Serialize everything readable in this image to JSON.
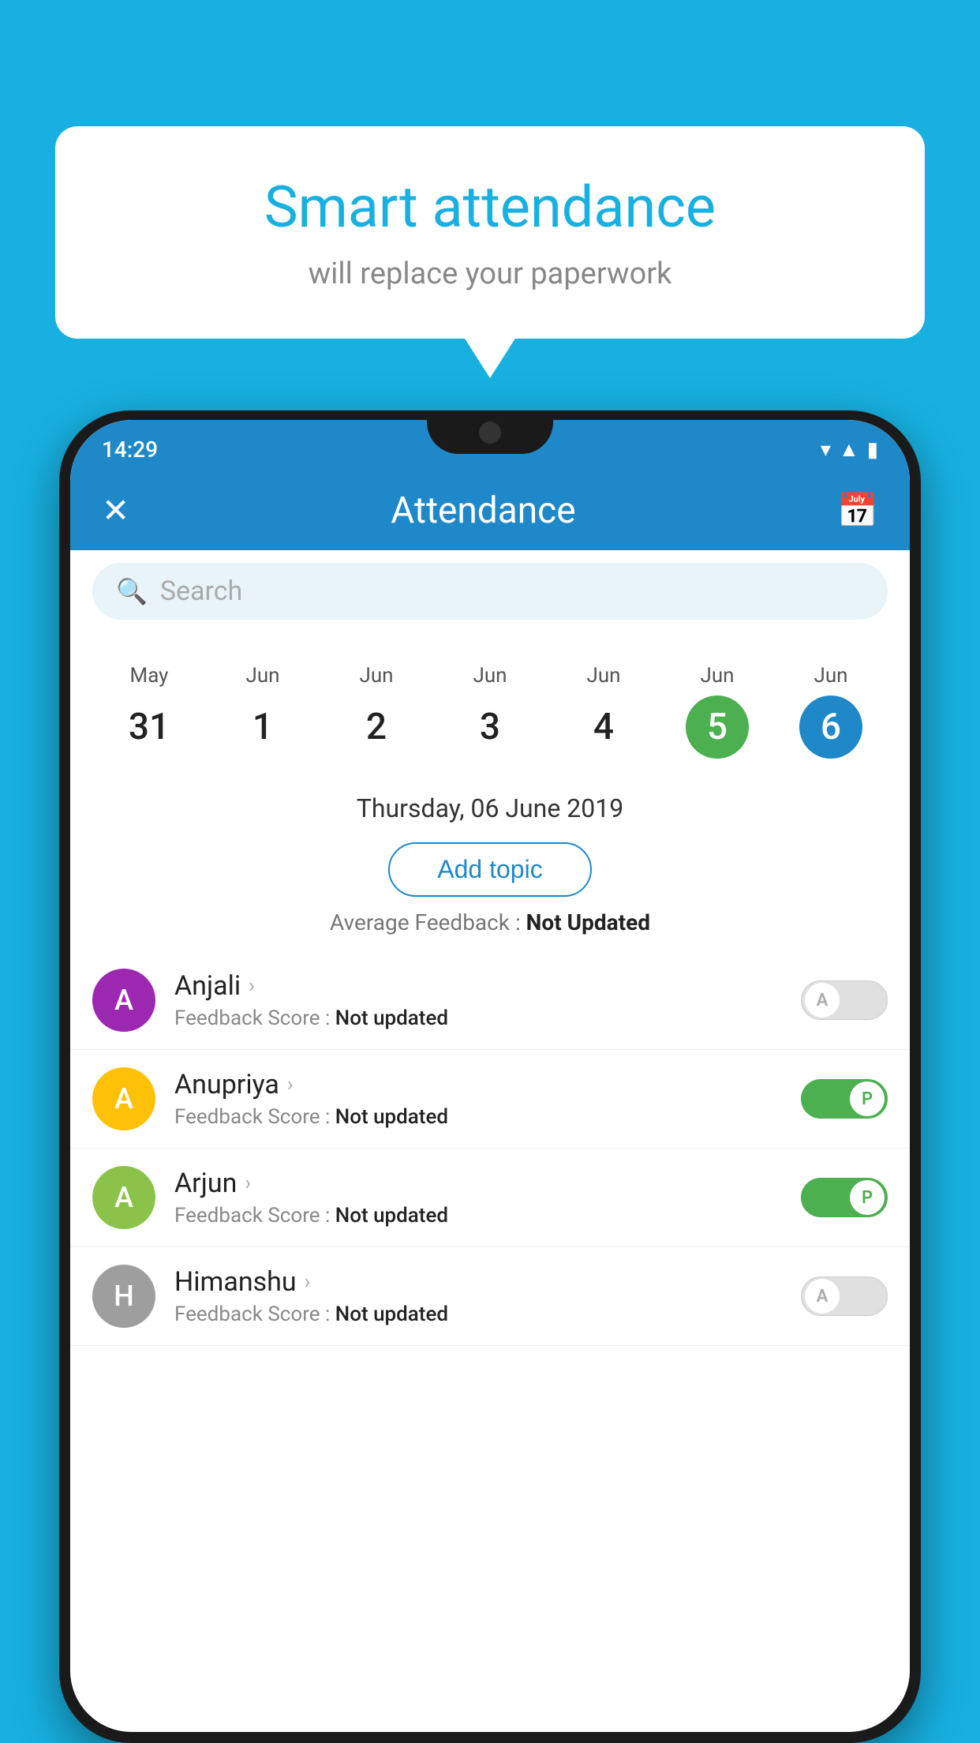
{
  "background": {
    "color": "#18b0e0"
  },
  "bubble": {
    "title": "Smart attendance",
    "subtitle": "will replace your paperwork"
  },
  "statusBar": {
    "time": "14:29",
    "wifi": "▾",
    "signal": "▲",
    "battery": "▮"
  },
  "appBar": {
    "title": "Attendance",
    "close_label": "✕",
    "calendar_label": "📅"
  },
  "search": {
    "placeholder": "Search"
  },
  "calendar": {
    "days": [
      {
        "month": "May",
        "date": "31",
        "state": "normal"
      },
      {
        "month": "Jun",
        "date": "1",
        "state": "normal"
      },
      {
        "month": "Jun",
        "date": "2",
        "state": "normal"
      },
      {
        "month": "Jun",
        "date": "3",
        "state": "normal"
      },
      {
        "month": "Jun",
        "date": "4",
        "state": "normal"
      },
      {
        "month": "Jun",
        "date": "5",
        "state": "today"
      },
      {
        "month": "Jun",
        "date": "6",
        "state": "selected"
      }
    ]
  },
  "selectedDate": "Thursday, 06 June 2019",
  "addTopicLabel": "Add topic",
  "avgFeedback": {
    "label": "Average Feedback : ",
    "value": "Not Updated"
  },
  "students": [
    {
      "name": "Anjali",
      "avatarInitial": "A",
      "avatarColor": "#9c27b0",
      "feedback": "Feedback Score : ",
      "feedbackValue": "Not updated",
      "attendance": "absent"
    },
    {
      "name": "Anupriya",
      "avatarInitial": "A",
      "avatarColor": "#ffc107",
      "feedback": "Feedback Score : ",
      "feedbackValue": "Not updated",
      "attendance": "present"
    },
    {
      "name": "Arjun",
      "avatarInitial": "A",
      "avatarColor": "#8bc34a",
      "feedback": "Feedback Score : ",
      "feedbackValue": "Not updated",
      "attendance": "present"
    },
    {
      "name": "Himanshu",
      "avatarInitial": "H",
      "avatarColor": "#9e9e9e",
      "feedback": "Feedback Score : ",
      "feedbackValue": "Not updated",
      "attendance": "absent"
    }
  ],
  "toggleLabels": {
    "absent": "A",
    "present": "P"
  }
}
